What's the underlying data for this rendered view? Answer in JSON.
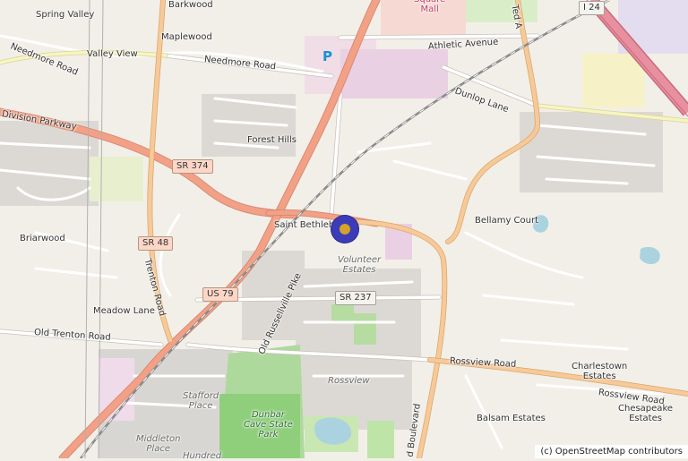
{
  "labels": {
    "spring_valley": "Spring Valley",
    "barkwood": "Barkwood",
    "maplewood": "Maplewood",
    "valley_view": "Valley View",
    "needmore_road_w": "Needmore Road",
    "needmore_road": "Needmore Road",
    "athletic_avenue": "Athletic Avenue",
    "dunlop_lane": "Dunlop Lane",
    "division_parkway": "Division Parkway",
    "forest_hills": "Forest Hills",
    "briarwood": "Briarwood",
    "saint_bethlehem": "Saint Bethlehem",
    "bellamy_court": "Bellamy Court",
    "trenton_road": "Trenton Road",
    "old_russellville_pike": "Old Russellville Pike",
    "meadow_lane": "Meadow Lane",
    "old_trenton_road": "Old Trenton Road",
    "rossview_road": "Rossview Road",
    "rossview_road_e": "Rossview Road",
    "charlestown_estates": "Charlestown\nEstates",
    "chesapeake_estates": "Chesapeake\nEstates",
    "balsam_estates": "Balsam Estates",
    "rossview": "Rossview",
    "volunteer_estates": "Volunteer\nEstates",
    "stafford_place": "Stafford\nPlace",
    "middleton_place": "Middleton\nPlace",
    "hundred": "Hundred",
    "dunbar_cave": "Dunbar\nCave State\nPark",
    "square_mall": "Square\nMall",
    "ted_a": "Ted A",
    "boulevard": "d Boulevard"
  },
  "shields": {
    "sr374": "SR 374",
    "sr48": "SR 48",
    "us79": "US 79",
    "sr237": "SR 237",
    "i24": "I 24"
  },
  "parking_symbol": "P",
  "attribution": "(c) OpenStreetMap contributors",
  "colors": {
    "background": "#f2efe9",
    "primary_road": "#f3a186",
    "secondary_road": "#f7c99a",
    "tertiary_road": "#fdfbe0",
    "motorway": "#e990a0",
    "park": "#c8e3b0",
    "forest": "#9cce86",
    "residential": "#e0ddd8",
    "retail": "#fbdbe0",
    "marker": "#3c3cb8",
    "marker_center": "#d4a32a"
  }
}
